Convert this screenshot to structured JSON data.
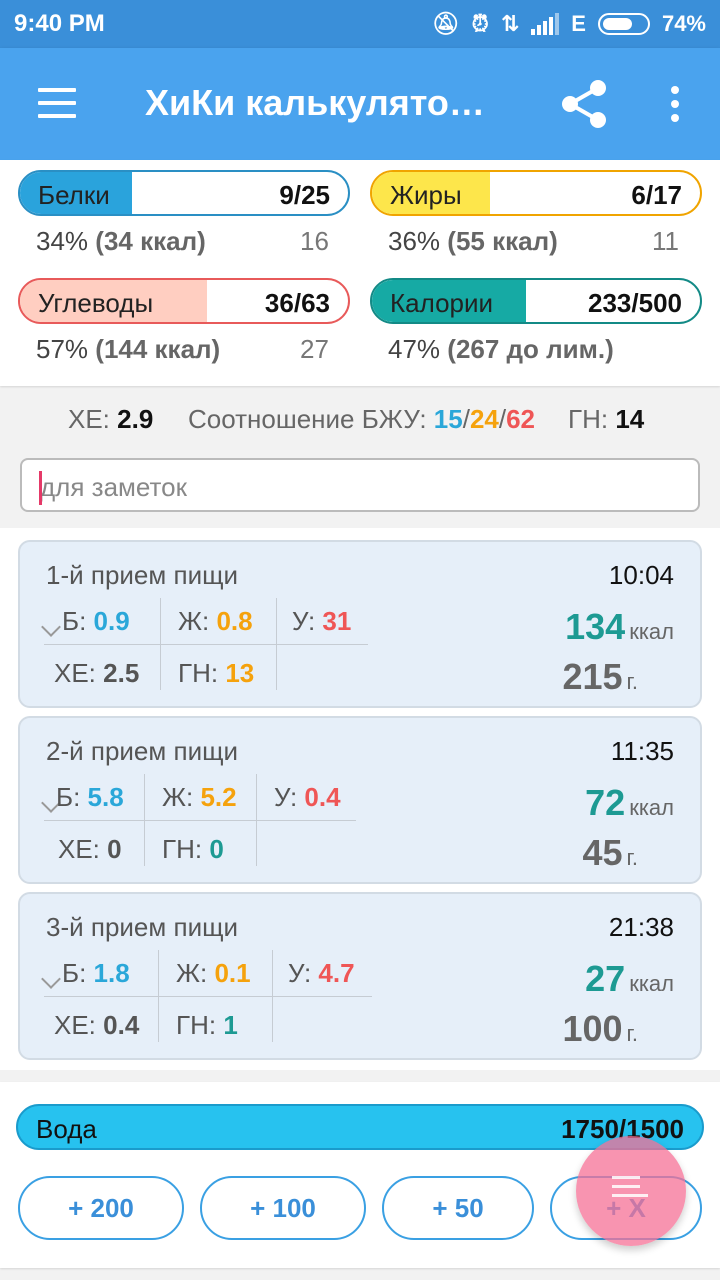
{
  "status_bar": {
    "time": "9:40 PM",
    "network": "E",
    "battery": "74%",
    "battery_level": 0.74,
    "icons": [
      "mute-icon",
      "alarm-icon",
      "data-arrows-icon",
      "signal-icon",
      "battery-icon"
    ]
  },
  "app_bar": {
    "title": "ХиКи калькулято…",
    "icons": [
      "menu-icon",
      "share-icon",
      "more-vert-icon"
    ]
  },
  "summary": {
    "protein": {
      "label": "Белки",
      "value": "9/25",
      "fraction": 0.34,
      "percent_text": "34%",
      "kcal_text": "(34 ккал)",
      "remaining": "16",
      "fill_color": "#2aa3dc",
      "border_color": "#2a8fc4"
    },
    "fat": {
      "label": "Жиры",
      "value": "6/17",
      "fraction": 0.36,
      "percent_text": "36%",
      "kcal_text": "(55 ккал)",
      "remaining": "11",
      "fill_color": "#fde64b",
      "border_color": "#f0a400"
    },
    "carbs": {
      "label": "Углеводы",
      "value": "36/63",
      "fraction": 0.57,
      "percent_text": "57%",
      "kcal_text": "(144 ккал)",
      "remaining": "27",
      "fill_color": "#ffcec1",
      "border_color": "#e85a5a"
    },
    "calories": {
      "label": "Калории",
      "value": "233/500",
      "fraction": 0.47,
      "percent_text": "47%",
      "kcal_text": "(267 до лим.)",
      "fill_color": "#16aaa4",
      "border_color": "#138a86"
    }
  },
  "stats": {
    "xe_label": "ХЕ:",
    "xe_value": "2.9",
    "ratio_label": "Соотношение БЖУ:",
    "ratio_p": "15",
    "ratio_f": "24",
    "ratio_c": "62",
    "sep": "/",
    "gn_label": "ГН:",
    "gn_value": "14"
  },
  "note": {
    "placeholder": "для заметок"
  },
  "meals": [
    {
      "name": "1-й прием пищи",
      "time": "10:04",
      "p_label": "Б:",
      "p": "0.9",
      "f_label": "Ж:",
      "f": "0.8",
      "c_label": "У:",
      "c": "31",
      "xe_label": "ХЕ:",
      "xe": "2.5",
      "gn_label": "ГН:",
      "gn": "13",
      "kcal": "134",
      "kcal_unit": "ккал",
      "grams": "215",
      "grams_unit": "г."
    },
    {
      "name": "2-й прием пищи",
      "time": "11:35",
      "p_label": "Б:",
      "p": "5.8",
      "f_label": "Ж:",
      "f": "5.2",
      "c_label": "У:",
      "c": "0.4",
      "xe_label": "ХЕ:",
      "xe": "0",
      "gn_label": "ГН:",
      "gn": "0",
      "kcal": "72",
      "kcal_unit": "ккал",
      "grams": "45",
      "grams_unit": "г."
    },
    {
      "name": "3-й прием пищи",
      "time": "21:38",
      "p_label": "Б:",
      "p": "1.8",
      "f_label": "Ж:",
      "f": "0.1",
      "c_label": "У:",
      "c": "4.7",
      "xe_label": "ХЕ:",
      "xe": "0.4",
      "gn_label": "ГН:",
      "gn": "1",
      "kcal": "27",
      "kcal_unit": "ккал",
      "grams": "100",
      "grams_unit": "г."
    }
  ],
  "water": {
    "label": "Вода",
    "value": "1750/1500",
    "buttons": [
      "+ 200",
      "+ 100",
      "+ 50",
      "+ X"
    ]
  },
  "fab": {
    "icon": "add-list-icon"
  }
}
